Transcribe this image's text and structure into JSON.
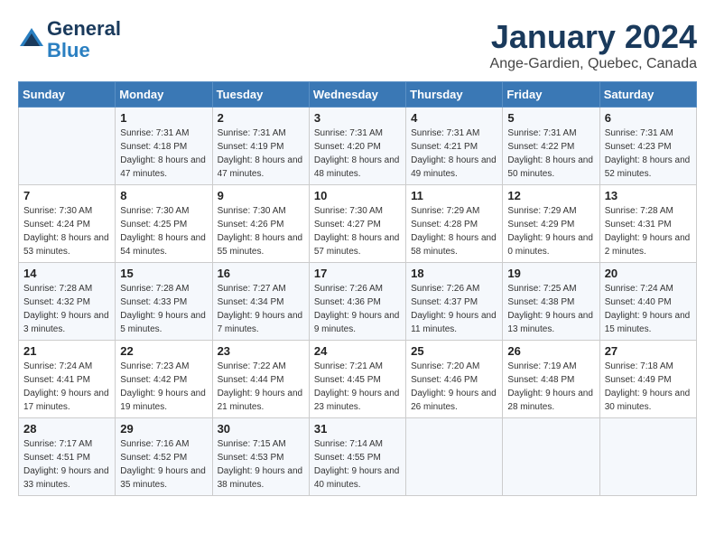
{
  "logo": {
    "line1": "General",
    "line2": "Blue"
  },
  "title": "January 2024",
  "location": "Ange-Gardien, Quebec, Canada",
  "headers": [
    "Sunday",
    "Monday",
    "Tuesday",
    "Wednesday",
    "Thursday",
    "Friday",
    "Saturday"
  ],
  "weeks": [
    [
      {
        "day": "",
        "sunrise": "",
        "sunset": "",
        "daylight": ""
      },
      {
        "day": "1",
        "sunrise": "Sunrise: 7:31 AM",
        "sunset": "Sunset: 4:18 PM",
        "daylight": "Daylight: 8 hours and 47 minutes."
      },
      {
        "day": "2",
        "sunrise": "Sunrise: 7:31 AM",
        "sunset": "Sunset: 4:19 PM",
        "daylight": "Daylight: 8 hours and 47 minutes."
      },
      {
        "day": "3",
        "sunrise": "Sunrise: 7:31 AM",
        "sunset": "Sunset: 4:20 PM",
        "daylight": "Daylight: 8 hours and 48 minutes."
      },
      {
        "day": "4",
        "sunrise": "Sunrise: 7:31 AM",
        "sunset": "Sunset: 4:21 PM",
        "daylight": "Daylight: 8 hours and 49 minutes."
      },
      {
        "day": "5",
        "sunrise": "Sunrise: 7:31 AM",
        "sunset": "Sunset: 4:22 PM",
        "daylight": "Daylight: 8 hours and 50 minutes."
      },
      {
        "day": "6",
        "sunrise": "Sunrise: 7:31 AM",
        "sunset": "Sunset: 4:23 PM",
        "daylight": "Daylight: 8 hours and 52 minutes."
      }
    ],
    [
      {
        "day": "7",
        "sunrise": "Sunrise: 7:30 AM",
        "sunset": "Sunset: 4:24 PM",
        "daylight": "Daylight: 8 hours and 53 minutes."
      },
      {
        "day": "8",
        "sunrise": "Sunrise: 7:30 AM",
        "sunset": "Sunset: 4:25 PM",
        "daylight": "Daylight: 8 hours and 54 minutes."
      },
      {
        "day": "9",
        "sunrise": "Sunrise: 7:30 AM",
        "sunset": "Sunset: 4:26 PM",
        "daylight": "Daylight: 8 hours and 55 minutes."
      },
      {
        "day": "10",
        "sunrise": "Sunrise: 7:30 AM",
        "sunset": "Sunset: 4:27 PM",
        "daylight": "Daylight: 8 hours and 57 minutes."
      },
      {
        "day": "11",
        "sunrise": "Sunrise: 7:29 AM",
        "sunset": "Sunset: 4:28 PM",
        "daylight": "Daylight: 8 hours and 58 minutes."
      },
      {
        "day": "12",
        "sunrise": "Sunrise: 7:29 AM",
        "sunset": "Sunset: 4:29 PM",
        "daylight": "Daylight: 9 hours and 0 minutes."
      },
      {
        "day": "13",
        "sunrise": "Sunrise: 7:28 AM",
        "sunset": "Sunset: 4:31 PM",
        "daylight": "Daylight: 9 hours and 2 minutes."
      }
    ],
    [
      {
        "day": "14",
        "sunrise": "Sunrise: 7:28 AM",
        "sunset": "Sunset: 4:32 PM",
        "daylight": "Daylight: 9 hours and 3 minutes."
      },
      {
        "day": "15",
        "sunrise": "Sunrise: 7:28 AM",
        "sunset": "Sunset: 4:33 PM",
        "daylight": "Daylight: 9 hours and 5 minutes."
      },
      {
        "day": "16",
        "sunrise": "Sunrise: 7:27 AM",
        "sunset": "Sunset: 4:34 PM",
        "daylight": "Daylight: 9 hours and 7 minutes."
      },
      {
        "day": "17",
        "sunrise": "Sunrise: 7:26 AM",
        "sunset": "Sunset: 4:36 PM",
        "daylight": "Daylight: 9 hours and 9 minutes."
      },
      {
        "day": "18",
        "sunrise": "Sunrise: 7:26 AM",
        "sunset": "Sunset: 4:37 PM",
        "daylight": "Daylight: 9 hours and 11 minutes."
      },
      {
        "day": "19",
        "sunrise": "Sunrise: 7:25 AM",
        "sunset": "Sunset: 4:38 PM",
        "daylight": "Daylight: 9 hours and 13 minutes."
      },
      {
        "day": "20",
        "sunrise": "Sunrise: 7:24 AM",
        "sunset": "Sunset: 4:40 PM",
        "daylight": "Daylight: 9 hours and 15 minutes."
      }
    ],
    [
      {
        "day": "21",
        "sunrise": "Sunrise: 7:24 AM",
        "sunset": "Sunset: 4:41 PM",
        "daylight": "Daylight: 9 hours and 17 minutes."
      },
      {
        "day": "22",
        "sunrise": "Sunrise: 7:23 AM",
        "sunset": "Sunset: 4:42 PM",
        "daylight": "Daylight: 9 hours and 19 minutes."
      },
      {
        "day": "23",
        "sunrise": "Sunrise: 7:22 AM",
        "sunset": "Sunset: 4:44 PM",
        "daylight": "Daylight: 9 hours and 21 minutes."
      },
      {
        "day": "24",
        "sunrise": "Sunrise: 7:21 AM",
        "sunset": "Sunset: 4:45 PM",
        "daylight": "Daylight: 9 hours and 23 minutes."
      },
      {
        "day": "25",
        "sunrise": "Sunrise: 7:20 AM",
        "sunset": "Sunset: 4:46 PM",
        "daylight": "Daylight: 9 hours and 26 minutes."
      },
      {
        "day": "26",
        "sunrise": "Sunrise: 7:19 AM",
        "sunset": "Sunset: 4:48 PM",
        "daylight": "Daylight: 9 hours and 28 minutes."
      },
      {
        "day": "27",
        "sunrise": "Sunrise: 7:18 AM",
        "sunset": "Sunset: 4:49 PM",
        "daylight": "Daylight: 9 hours and 30 minutes."
      }
    ],
    [
      {
        "day": "28",
        "sunrise": "Sunrise: 7:17 AM",
        "sunset": "Sunset: 4:51 PM",
        "daylight": "Daylight: 9 hours and 33 minutes."
      },
      {
        "day": "29",
        "sunrise": "Sunrise: 7:16 AM",
        "sunset": "Sunset: 4:52 PM",
        "daylight": "Daylight: 9 hours and 35 minutes."
      },
      {
        "day": "30",
        "sunrise": "Sunrise: 7:15 AM",
        "sunset": "Sunset: 4:53 PM",
        "daylight": "Daylight: 9 hours and 38 minutes."
      },
      {
        "day": "31",
        "sunrise": "Sunrise: 7:14 AM",
        "sunset": "Sunset: 4:55 PM",
        "daylight": "Daylight: 9 hours and 40 minutes."
      },
      {
        "day": "",
        "sunrise": "",
        "sunset": "",
        "daylight": ""
      },
      {
        "day": "",
        "sunrise": "",
        "sunset": "",
        "daylight": ""
      },
      {
        "day": "",
        "sunrise": "",
        "sunset": "",
        "daylight": ""
      }
    ]
  ]
}
